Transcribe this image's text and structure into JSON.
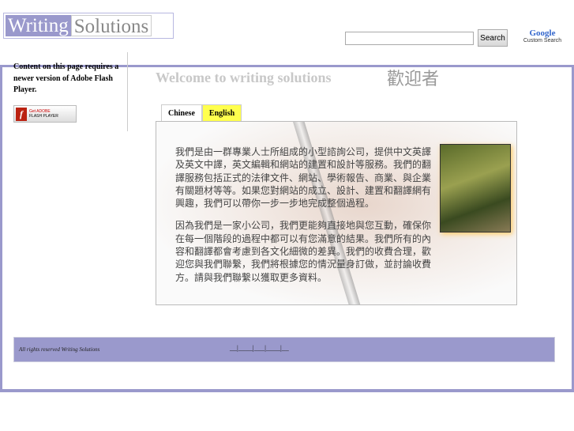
{
  "header": {
    "logo_part1": "Writing",
    "logo_part2": "Solutions",
    "search_value": "",
    "search_button": "Search",
    "google_logo": "Google",
    "google_sub": "Custom Search"
  },
  "sidebar": {
    "flash_notice": "Content on this page requires a newer version of Adobe Flash Player.",
    "flash_badge_line1": "Get ADOBE",
    "flash_badge_line2": "FLASH PLAYER"
  },
  "main": {
    "welcome": "Welcome to writing solutions",
    "welcome_zh": "歡迎者",
    "tabs": [
      {
        "label": "Chinese"
      },
      {
        "label": "English"
      }
    ],
    "paragraphs": [
      "我們是由一群專業人士所組成的小型諮詢公司，提供中文英譯及英文中譯，英文編輯和網站的建置和設計等服務。我們的翻譯服務包括正式的法律文件、網站、學術報告、商業、與企業有關題材等等。如果您對網站的成立、設計、建置和翻譯網有興趣，我們可以帶你一步一步地完成整個過程。",
      "因為我們是一家小公司，我們更能夠直接地與您互動，確保你在每一個階段的過程中都可以有您滿意的結果。我們所有的內容和翻譯都會考慮到各文化細微的差異。我們的收費合理，歡迎您與我們聯繫，我們將根據您的情況量身訂做，並討論收費方。請與我們聯繫以獲取更多資料。"
    ]
  },
  "footer": {
    "copyright": "All rights reserved Writing Solutions",
    "links": [
      "__",
      "____",
      "___",
      "____",
      "__"
    ]
  }
}
